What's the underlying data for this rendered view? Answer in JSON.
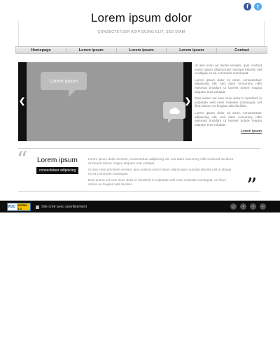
{
  "social": {
    "facebook": "f",
    "twitter": "t"
  },
  "header": {
    "title": "Lorem ipsum dolor",
    "subtitle": "CONSECTETUER ADIPISCING ELIT, SED DIAM"
  },
  "nav": [
    {
      "label": "Homepage"
    },
    {
      "label": "Lorem ipsum"
    },
    {
      "label": "Lorem ipsum"
    },
    {
      "label": "Lorem ipsum"
    },
    {
      "label": "Contact"
    }
  ],
  "slider": {
    "bubble_text": "Lorem ipsum",
    "prev": "❮",
    "next": "❯"
  },
  "side": {
    "paragraphs": [
      "Ut wisi enim ad minim veniam, quis nostrud exerci tation ullamcorper suscipit lobortis nisl ut aliquip ex ea commodo consequat.",
      "Lorem ipsum dolor sit amet, consectetuer adipiscing elit, sed diam nonummy nibh euismod tincidunt ut laoreet dolore magna aliquam erat volutpat.",
      "Duis autem vel eum iriure dolor in hendrerit in vulputate velit esse molestie consequat, vel illum dolore eu feugiat nulla facilisis.",
      "Lorem ipsum dolor sit amet, consectetuer adipiscing elit, sed diam nonummy nibh euismod tincidunt ut laoreet dolore magna aliquam erat volutpat."
    ],
    "more": "Lorem ipsum"
  },
  "quote": {
    "title": "Lorem ipsum",
    "tag": "consectetuer adipiscing",
    "paragraphs": [
      "Lorem ipsum dolor sit amet, consectetuer adipiscing elit, sed diam nonummy nibh euismod tincidunt ut laoreet dolore magna aliquam erat volutpat.",
      "Ut wisi enim ad minim veniam, quis nostrud exerci tation ullamcorper suscipit lobortis nisl ut aliquip ex ea commodo consequat.",
      "Duis autem vel eum iriure dolor in hendrerit in vulputate velit esse molestie consequat, vel illum dolore eu feugiat nulla facilisis."
    ],
    "open_mark": "“",
    "close_mark": "”"
  },
  "footer": {
    "w3c": "W3C",
    "w3c_badge": "XHTML 1.0",
    "credit": "Site créé avec openElement"
  }
}
